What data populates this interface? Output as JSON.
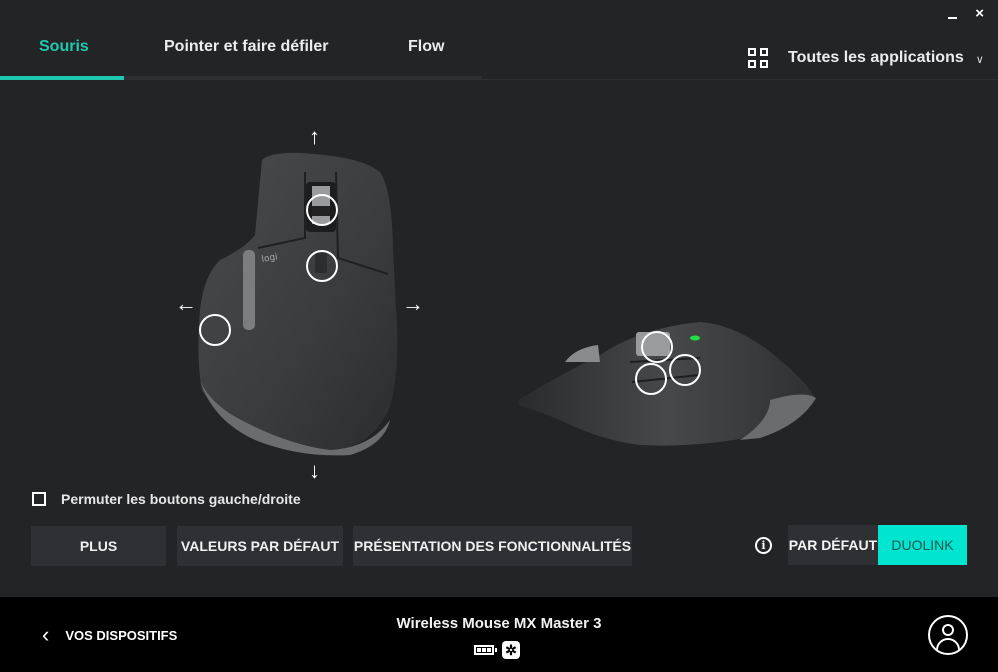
{
  "window": {
    "minimize_icon": "minimize-icon",
    "close_label": "×"
  },
  "tabs": [
    {
      "label": "Souris",
      "active": true
    },
    {
      "label": "Pointer et faire défiler",
      "active": false
    },
    {
      "label": "Flow",
      "active": false
    }
  ],
  "app_selector": {
    "icon": "grid-icon",
    "label": "Toutes les applications",
    "chevron": "⌄"
  },
  "mouse_view": {
    "arrows": {
      "up": "↑",
      "down": "↓",
      "left": "←",
      "right": "→"
    },
    "led_color": "#22dd44"
  },
  "swap_buttons": {
    "label": "Permuter les boutons gauche/droite",
    "checked": false
  },
  "buttons": {
    "more": "PLUS",
    "defaults": "VALEURS PAR DÉFAUT",
    "features": "PRÉSENTATION DES FONCTIONNALITÉS"
  },
  "mode_toggle": {
    "info_icon": "i",
    "default_label": "PAR DÉFAUT",
    "duolink_label": "DUOLINK",
    "selected": "DUOLINK"
  },
  "footer": {
    "back_chevron": "‹",
    "back_label": "VOS DISPOSITIFS",
    "device_name": "Wireless Mouse MX Master 3",
    "battery_level": "3/3",
    "receiver_icon": "✲"
  },
  "colors": {
    "accent": "#1fc9b0",
    "duolink_bg": "#00e5cf",
    "background": "#232426",
    "footer_bg": "#000000"
  }
}
